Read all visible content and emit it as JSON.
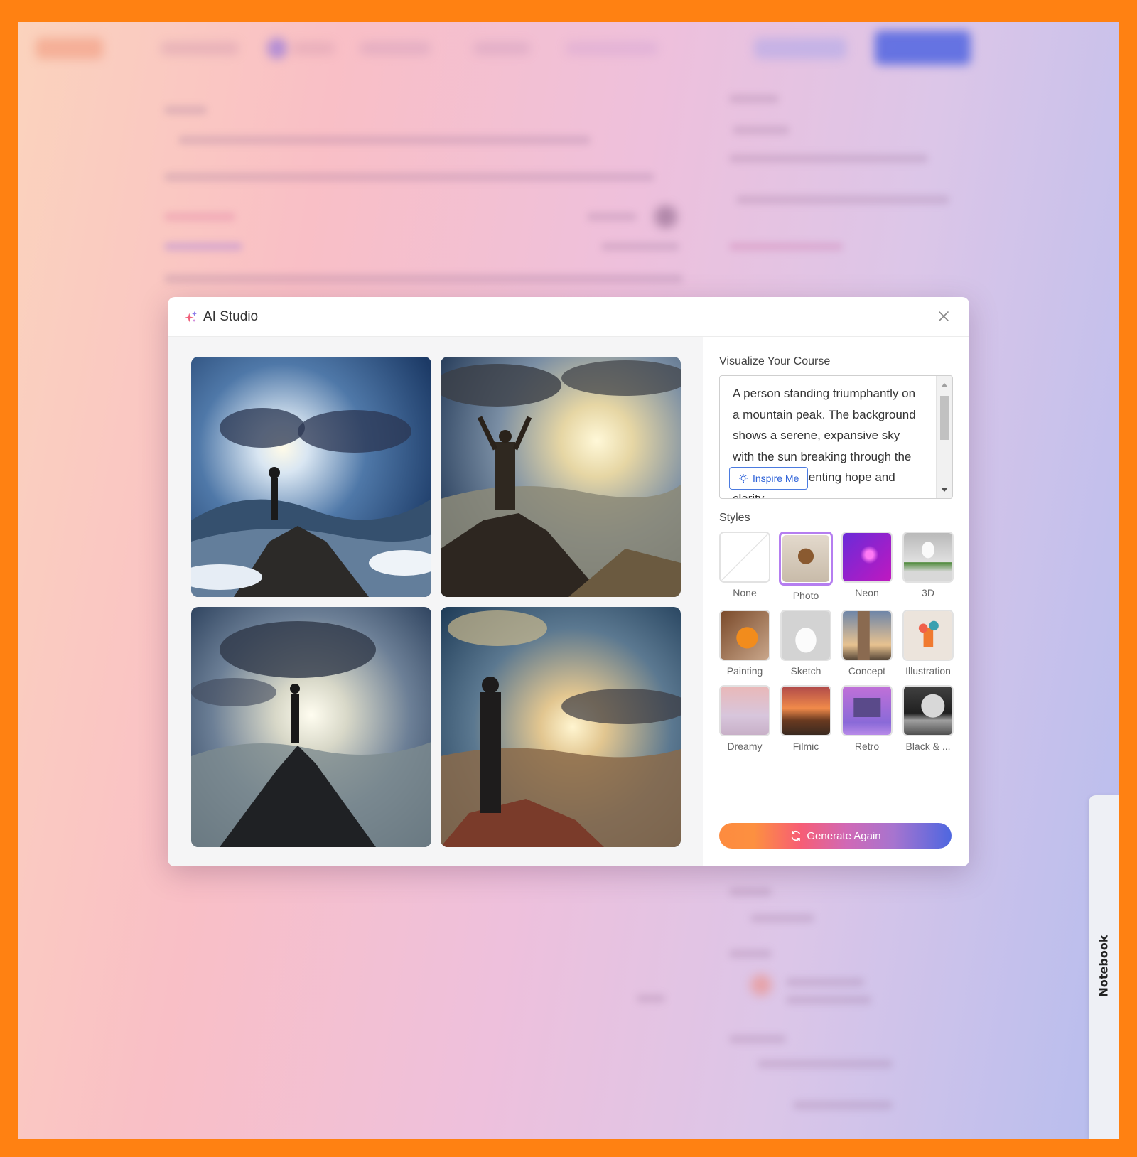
{
  "modal": {
    "title": "AI Studio",
    "sparkle_icon": "sparkle-icon",
    "close_icon": "close-icon",
    "generated_images": [
      {
        "alt": "Silhouette of woman on rocky mountain peak under dramatic clouds and sun"
      },
      {
        "alt": "Robed figure with raised arms on mountain peak at sunrise"
      },
      {
        "alt": "Silhouette of woman standing on jagged peak facing sun behind clouds"
      },
      {
        "alt": "Woman standing on red rock ledge overlooking sunlit mountain valley"
      }
    ],
    "prompt": {
      "label": "Visualize Your Course",
      "text": "A person standing triumphantly on a mountain peak. The background shows a serene, expansive sky with the sun breaking through the clouds, representing hope and clarity.",
      "inspire_label": "Inspire Me",
      "inspire_icon": "lightbulb-icon"
    },
    "styles": {
      "label": "Styles",
      "selected": "Photo",
      "items": [
        {
          "name": "None"
        },
        {
          "name": "Photo"
        },
        {
          "name": "Neon"
        },
        {
          "name": "3D"
        },
        {
          "name": "Painting"
        },
        {
          "name": "Sketch"
        },
        {
          "name": "Concept"
        },
        {
          "name": "Illustration"
        },
        {
          "name": "Dreamy"
        },
        {
          "name": "Filmic"
        },
        {
          "name": "Retro"
        },
        {
          "name": "Black & ..."
        }
      ]
    },
    "generate_label": "Generate Again",
    "generate_icon": "refresh-icon",
    "colors": {
      "gradient_start": "#fd8b3f",
      "gradient_mid": "#f75d75",
      "gradient_end": "#4e67e0",
      "selected_border": "#b57ef0",
      "inspire_blue": "#2f63d8",
      "frame": "#ff8112"
    }
  },
  "notebook_tab": {
    "label": "Notebook"
  }
}
